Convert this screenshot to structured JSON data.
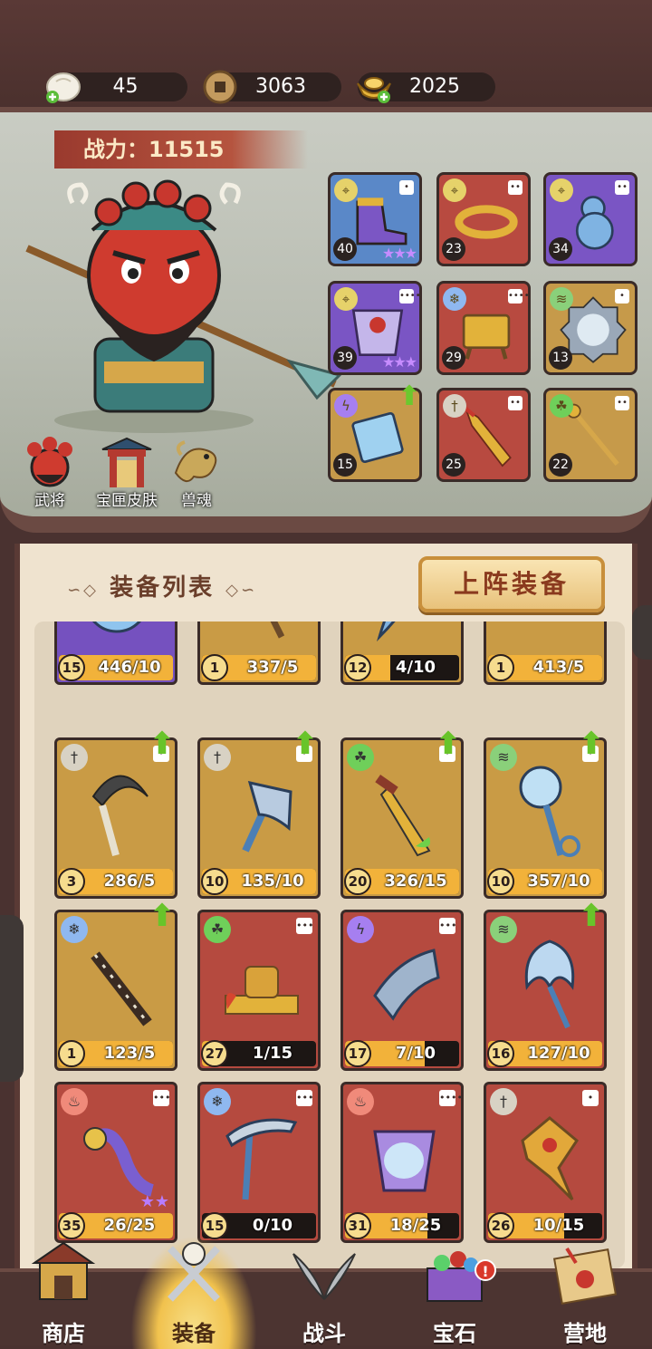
{
  "currencies": [
    {
      "icon": "steamed-bun-icon",
      "value": "45"
    },
    {
      "icon": "copper-coin-icon",
      "value": "3063"
    },
    {
      "icon": "gold-ingot-icon",
      "value": "2025"
    }
  ],
  "hero": {
    "power_label": "战力：11515",
    "buttons": [
      {
        "label": "武将",
        "icon": "general-portrait-icon"
      },
      {
        "label": "宝匣皮肤",
        "icon": "gate-pavilion-icon"
      },
      {
        "label": "兽魂",
        "icon": "beast-soul-icon"
      }
    ],
    "slots": [
      {
        "level": "40",
        "rarity": "blue",
        "element": "target-icon",
        "stars": "★★★",
        "pips": 1,
        "upgrade": false,
        "item": "boot-icon"
      },
      {
        "level": "23",
        "rarity": "red",
        "element": "target-icon",
        "stars": "",
        "pips": 2,
        "upgrade": false,
        "item": "bracelet-icon"
      },
      {
        "level": "34",
        "rarity": "purple",
        "element": "target-icon",
        "stars": "",
        "pips": 2,
        "upgrade": false,
        "item": "gourd-icon"
      },
      {
        "level": "39",
        "rarity": "purple",
        "element": "target-icon",
        "stars": "★★★",
        "pips": 4,
        "upgrade": false,
        "item": "armor-icon"
      },
      {
        "level": "29",
        "rarity": "red",
        "element": "snowflake-icon",
        "stars": "",
        "pips": 4,
        "upgrade": false,
        "item": "cauldron-icon"
      },
      {
        "level": "13",
        "rarity": "gold",
        "element": "wind-icon",
        "stars": "",
        "pips": 1,
        "upgrade": false,
        "item": "mirror-icon"
      },
      {
        "level": "15",
        "rarity": "gold",
        "element": "lightning-icon",
        "stars": "",
        "pips": 0,
        "upgrade": true,
        "item": "scroll-icon"
      },
      {
        "level": "25",
        "rarity": "red",
        "element": "sword-icon",
        "stars": "",
        "pips": 2,
        "upgrade": false,
        "item": "blade-icon"
      },
      {
        "level": "22",
        "rarity": "gold",
        "element": "poison-icon",
        "stars": "",
        "pips": 2,
        "upgrade": false,
        "item": "staff-icon"
      }
    ]
  },
  "equipment": {
    "title": "装备列表",
    "deploy_label": "上阵装备",
    "items": [
      {
        "level": "15",
        "count": "446/10",
        "fill": 1.0,
        "rarity": "purple",
        "element": "",
        "upgrade": false,
        "pips": 0,
        "stars": "",
        "item": "orb-icon"
      },
      {
        "level": "1",
        "count": "337/5",
        "fill": 1.0,
        "rarity": "gold",
        "element": "",
        "upgrade": false,
        "pips": 0,
        "stars": "",
        "item": "axe-icon"
      },
      {
        "level": "12",
        "count": "4/10",
        "fill": 0.4,
        "rarity": "gold",
        "element": "",
        "upgrade": false,
        "pips": 0,
        "stars": "",
        "item": "feather-icon"
      },
      {
        "level": "1",
        "count": "413/5",
        "fill": 1.0,
        "rarity": "gold",
        "element": "",
        "upgrade": false,
        "pips": 0,
        "stars": "",
        "item": "fang-icon"
      },
      {
        "level": "3",
        "count": "286/5",
        "fill": 1.0,
        "rarity": "gold",
        "element": "sword-icon",
        "upgrade": true,
        "pips": 1,
        "stars": "",
        "item": "sickle-icon"
      },
      {
        "level": "10",
        "count": "135/10",
        "fill": 1.0,
        "rarity": "gold",
        "element": "sword-icon",
        "upgrade": true,
        "pips": 1,
        "stars": "",
        "item": "hammer-icon"
      },
      {
        "level": "20",
        "count": "326/15",
        "fill": 1.0,
        "rarity": "gold",
        "element": "poison-icon",
        "upgrade": true,
        "pips": 1,
        "stars": "",
        "item": "dagger-icon"
      },
      {
        "level": "10",
        "count": "357/10",
        "fill": 1.0,
        "rarity": "gold",
        "element": "wind-icon",
        "upgrade": true,
        "pips": 1,
        "stars": "",
        "item": "scepter-icon"
      },
      {
        "level": "1",
        "count": "123/5",
        "fill": 1.0,
        "rarity": "gold",
        "element": "snowflake-icon",
        "upgrade": true,
        "pips": 0,
        "stars": "",
        "item": "flute-icon"
      },
      {
        "level": "27",
        "count": "1/15",
        "fill": 0.07,
        "rarity": "red",
        "element": "poison-icon",
        "upgrade": false,
        "pips": 3,
        "stars": "",
        "item": "seal-icon"
      },
      {
        "level": "17",
        "count": "7/10",
        "fill": 0.7,
        "rarity": "red",
        "element": "lightning-icon",
        "upgrade": false,
        "pips": 3,
        "stars": "",
        "item": "gauntlet-icon"
      },
      {
        "level": "16",
        "count": "127/10",
        "fill": 1.0,
        "rarity": "red",
        "element": "wind-icon",
        "upgrade": true,
        "pips": 0,
        "stars": "",
        "item": "fan-icon"
      },
      {
        "level": "35",
        "count": "26/25",
        "fill": 1.0,
        "rarity": "red",
        "element": "fire-icon",
        "upgrade": false,
        "pips": 3,
        "stars": "★★",
        "item": "ruyi-icon"
      },
      {
        "level": "15",
        "count": "0/10",
        "fill": 0.0,
        "rarity": "red",
        "element": "snowflake-icon",
        "upgrade": false,
        "pips": 3,
        "stars": "",
        "item": "pickaxe-icon"
      },
      {
        "level": "31",
        "count": "18/25",
        "fill": 0.72,
        "rarity": "red",
        "element": "fire-icon",
        "upgrade": false,
        "pips": 4,
        "stars": "",
        "item": "mantle-icon"
      },
      {
        "level": "26",
        "count": "10/15",
        "fill": 0.67,
        "rarity": "red",
        "element": "sword-icon",
        "upgrade": false,
        "pips": 1,
        "stars": "",
        "item": "crest-icon"
      }
    ]
  },
  "nav": [
    {
      "label": "商店",
      "icon": "shop-icon",
      "active": false,
      "badge": ""
    },
    {
      "label": "装备",
      "icon": "crossed-swords-icon",
      "active": true,
      "badge": ""
    },
    {
      "label": "战斗",
      "icon": "battle-blades-icon",
      "active": false,
      "badge": ""
    },
    {
      "label": "宝石",
      "icon": "gem-chest-icon",
      "active": false,
      "badge": "!"
    },
    {
      "label": "营地",
      "icon": "camp-icon",
      "active": false,
      "badge": ""
    }
  ],
  "colors": {
    "gold_card": "#c99b45",
    "red_card": "#b54a3f",
    "purple_card": "#7551bf",
    "upgrade_arrow": "#68c42a",
    "progress": "#f2b23a",
    "frame": "#5a3a35"
  }
}
